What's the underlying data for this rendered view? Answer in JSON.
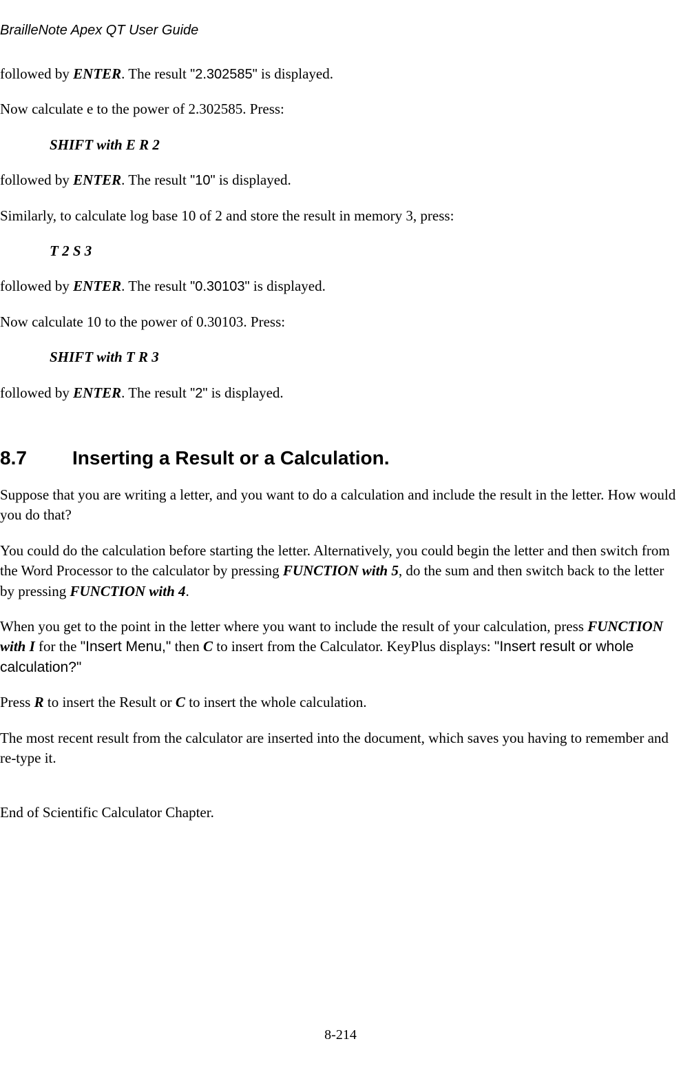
{
  "header_title": "BrailleNote Apex QT User Guide",
  "p1_a": "followed by ",
  "p1_b": "ENTER",
  "p1_c": ". The result ",
  "p1_d": "\"2.302585\"",
  "p1_e": " is displayed.",
  "p2": "Now calculate e to the power of 2.302585. Press:",
  "p3": "SHIFT with E R 2",
  "p4_a": "followed by ",
  "p4_b": "ENTER",
  "p4_c": ". The result ",
  "p4_d": "\"10\"",
  "p4_e": " is displayed.",
  "p5": "Similarly, to calculate log base 10 of 2 and store the result in memory 3, press:",
  "p6": "T 2 S 3",
  "p7_a": "followed by ",
  "p7_b": "ENTER",
  "p7_c": ". The result ",
  "p7_d": "\"0.30103\"",
  "p7_e": " is displayed.",
  "p8": "Now calculate 10 to the power of 0.30103. Press:",
  "p9": "SHIFT with T R 3",
  "p10_a": "followed by ",
  "p10_b": "ENTER",
  "p10_c": ". The result ",
  "p10_d": "\"2\"",
  "p10_e": " is displayed.",
  "hnum": "8.7",
  "htitle": "Inserting a Result or a Calculation.",
  "p11": "Suppose that you are writing a letter, and you want to do a calculation and include the result in the letter. How would you do that?",
  "p12_a": "You could do the calculation before starting the letter. Alternatively, you could begin the letter and then switch from the Word Processor to the calculator by pressing ",
  "p12_b": "FUNCTION with 5",
  "p12_c": ", do the sum and then switch back to the letter by pressing ",
  "p12_d": "FUNCTION with 4",
  "p12_e": ".",
  "p13_a": "When you get to the point in the letter where you want to include the result of your calculation, press ",
  "p13_b": "FUNCTION with I",
  "p13_c": " for the ",
  "p13_d": "\"Insert Menu,\"",
  "p13_e": " then ",
  "p13_f": "C",
  "p13_g": " to insert from the Calculator. KeyPlus displays: ",
  "p13_h": "\"Insert result or whole calculation?\"",
  "p14_a": "Press ",
  "p14_b": "R",
  "p14_c": " to insert the Result or ",
  "p14_d": "C",
  "p14_e": " to insert the whole calculation.",
  "p15": "The most recent result from the calculator are inserted into the document, which saves you having to remember and re-type it.",
  "p16": "End of Scientific Calculator Chapter.",
  "footer": "8-214"
}
